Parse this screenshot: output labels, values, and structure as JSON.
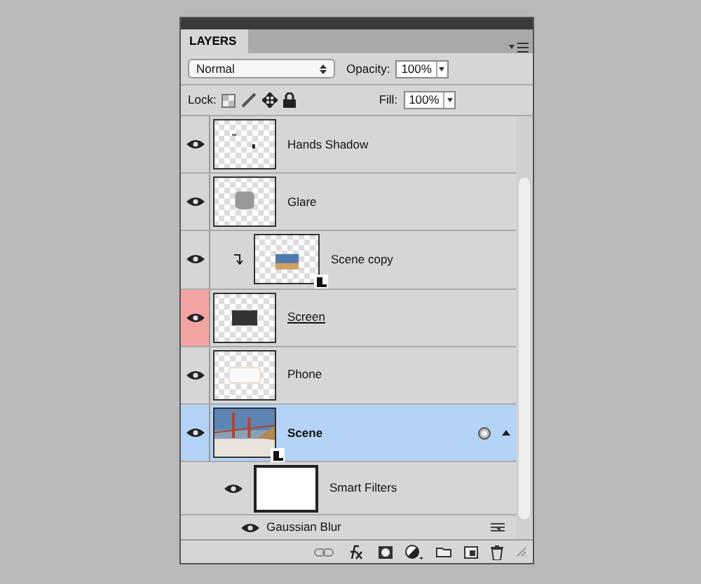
{
  "panel": {
    "tab": "LAYERS",
    "blend_mode": "Normal",
    "opacity_label": "Opacity:",
    "opacity": "100%",
    "lock_label": "Lock:",
    "fill_label": "Fill:",
    "fill": "100%"
  },
  "layers": [
    {
      "name": "Hands Shadow",
      "kind": "marks",
      "visible": true,
      "selected": false
    },
    {
      "name": "Glare",
      "kind": "glare",
      "visible": true,
      "selected": false
    },
    {
      "name": "Scene copy",
      "kind": "small-photo",
      "visible": true,
      "selected": false,
      "clipped": true,
      "smart_object": true
    },
    {
      "name": "Screen",
      "kind": "rectangle",
      "visible": true,
      "selected": false,
      "clip_base": true,
      "color": "#f4a3a3"
    },
    {
      "name": "Phone",
      "kind": "light-shape",
      "visible": true,
      "selected": false
    },
    {
      "name": "Scene",
      "visible": true,
      "selected": true,
      "smart_object": true,
      "expanded": true,
      "children": [
        {
          "kind": "filter_mask",
          "name": "Smart Filters",
          "visible": true
        },
        {
          "kind": "filter",
          "name": "Gaussian Blur",
          "visible": true
        }
      ]
    }
  ]
}
